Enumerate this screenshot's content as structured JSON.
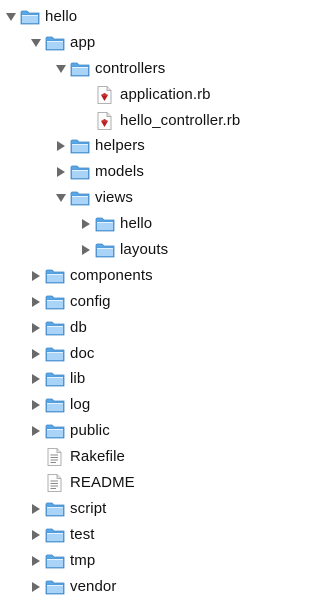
{
  "tree": [
    {
      "label": "hello",
      "type": "folder",
      "depth": 0,
      "expanded": true,
      "icon": "folder-icon"
    },
    {
      "label": "app",
      "type": "folder",
      "depth": 1,
      "expanded": true,
      "icon": "folder-icon"
    },
    {
      "label": "controllers",
      "type": "folder",
      "depth": 2,
      "expanded": true,
      "icon": "folder-icon"
    },
    {
      "label": "application.rb",
      "type": "file",
      "depth": 3,
      "icon": "ruby-file-icon"
    },
    {
      "label": "hello_controller.rb",
      "type": "file",
      "depth": 3,
      "icon": "ruby-file-icon"
    },
    {
      "label": "helpers",
      "type": "folder",
      "depth": 2,
      "expanded": false,
      "icon": "folder-icon"
    },
    {
      "label": "models",
      "type": "folder",
      "depth": 2,
      "expanded": false,
      "icon": "folder-icon"
    },
    {
      "label": "views",
      "type": "folder",
      "depth": 2,
      "expanded": true,
      "icon": "folder-icon"
    },
    {
      "label": "hello",
      "type": "folder",
      "depth": 3,
      "expanded": false,
      "icon": "folder-icon"
    },
    {
      "label": "layouts",
      "type": "folder",
      "depth": 3,
      "expanded": false,
      "icon": "folder-icon"
    },
    {
      "label": "components",
      "type": "folder",
      "depth": 1,
      "expanded": false,
      "icon": "folder-icon"
    },
    {
      "label": "config",
      "type": "folder",
      "depth": 1,
      "expanded": false,
      "icon": "folder-icon"
    },
    {
      "label": "db",
      "type": "folder",
      "depth": 1,
      "expanded": false,
      "icon": "folder-icon"
    },
    {
      "label": "doc",
      "type": "folder",
      "depth": 1,
      "expanded": false,
      "icon": "folder-icon"
    },
    {
      "label": "lib",
      "type": "folder",
      "depth": 1,
      "expanded": false,
      "icon": "folder-icon"
    },
    {
      "label": "log",
      "type": "folder",
      "depth": 1,
      "expanded": false,
      "icon": "folder-icon"
    },
    {
      "label": "public",
      "type": "folder",
      "depth": 1,
      "expanded": false,
      "icon": "folder-icon"
    },
    {
      "label": "Rakefile",
      "type": "file",
      "depth": 1,
      "icon": "text-file-icon"
    },
    {
      "label": "README",
      "type": "file",
      "depth": 1,
      "icon": "text-file-icon"
    },
    {
      "label": "script",
      "type": "folder",
      "depth": 1,
      "expanded": false,
      "icon": "folder-icon"
    },
    {
      "label": "test",
      "type": "folder",
      "depth": 1,
      "expanded": false,
      "icon": "folder-icon"
    },
    {
      "label": "tmp",
      "type": "folder",
      "depth": 1,
      "expanded": false,
      "icon": "folder-icon"
    },
    {
      "label": "vendor",
      "type": "folder",
      "depth": 1,
      "expanded": false,
      "icon": "folder-icon"
    }
  ],
  "colors": {
    "folder_light": "#a9d4f7",
    "folder_dark": "#5aa7e6",
    "folder_edge": "#3f86c8",
    "disclosure": "#6a6a6a",
    "ruby": "#b81d1d"
  }
}
